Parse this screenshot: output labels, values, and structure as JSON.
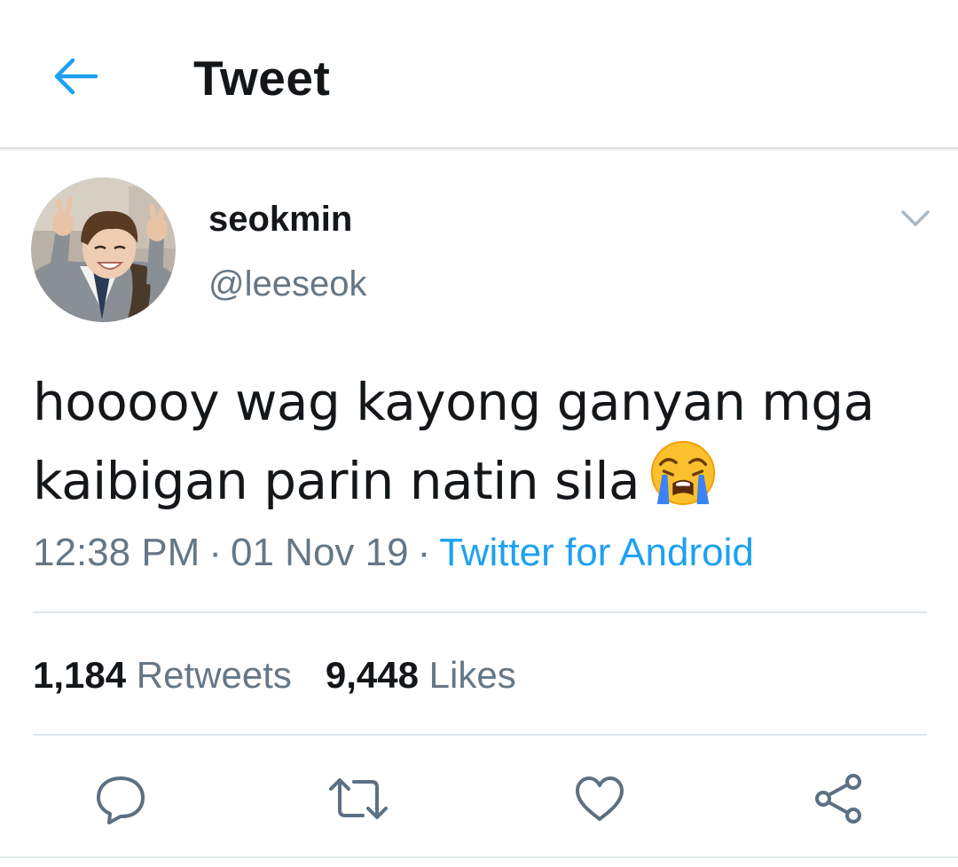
{
  "header": {
    "title": "Tweet"
  },
  "author": {
    "display_name": "seokmin",
    "handle": "@leeseok"
  },
  "tweet": {
    "text_line1": "hooooy wag kayong ganyan mga",
    "text_line2": "kaibigan parin natin sila",
    "emoji": "loudly-crying-face"
  },
  "meta": {
    "time": "12:38 PM",
    "separator": "·",
    "date": "01 Nov 19",
    "source": "Twitter for Android"
  },
  "stats": {
    "retweets_count": "1,184",
    "retweets_label": "Retweets",
    "likes_count": "9,448",
    "likes_label": "Likes"
  },
  "actions": [
    "reply-icon",
    "retweet-icon",
    "like-icon",
    "share-icon"
  ],
  "colors": {
    "accent": "#1da1f2",
    "text": "#14171a",
    "secondary": "#657786",
    "icon": "#5b7083",
    "divider": "#e1e8ed"
  }
}
